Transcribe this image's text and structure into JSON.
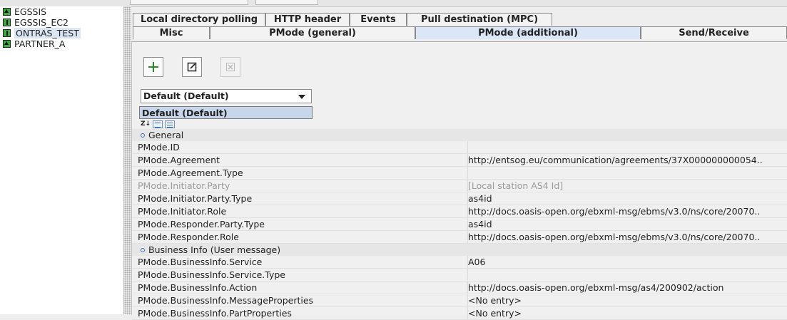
{
  "tree": {
    "items": [
      {
        "label": "EGSSIS",
        "icon": "green-up-icon",
        "selected": false
      },
      {
        "label": "EGSSIS_EC2",
        "icon": "green-info-icon",
        "selected": false
      },
      {
        "label": "ONTRAS_TEST",
        "icon": "green-info-icon",
        "selected": true
      },
      {
        "label": "PARTNER_A",
        "icon": "green-up-icon",
        "selected": false
      }
    ]
  },
  "tabs": {
    "row1": [
      "Local directory polling",
      "HTTP header",
      "Events",
      "Pull destination (MPC)"
    ],
    "row2": [
      "Misc",
      "PMode (general)",
      "PMode (additional)",
      "Send/Receive"
    ],
    "active": "PMode (additional)"
  },
  "toolbar": {
    "add_icon": "plus-icon",
    "edit_icon": "edit-icon",
    "delete_icon": "delete-icon"
  },
  "combo": {
    "selected": "Default (Default)",
    "popup_option": "Default (Default)"
  },
  "properties": {
    "groups": [
      {
        "title": "General",
        "rows": [
          {
            "key": "PMode.ID",
            "value": "",
            "disabled": false
          },
          {
            "key": "PMode.Agreement",
            "value": "http://entsog.eu/communication/agreements/37X000000000054..",
            "disabled": false
          },
          {
            "key": "PMode.Agreement.Type",
            "value": "",
            "disabled": false
          },
          {
            "key": "PMode.Initiator.Party",
            "value": "[Local station AS4 Id]",
            "disabled": true
          },
          {
            "key": "PMode.Initiator.Party.Type",
            "value": "as4id",
            "disabled": false
          },
          {
            "key": "PMode.Initiator.Role",
            "value": "http://docs.oasis-open.org/ebxml-msg/ebms/v3.0/ns/core/20070..",
            "disabled": false
          },
          {
            "key": "PMode.Responder.Party.Type",
            "value": "as4id",
            "disabled": false
          },
          {
            "key": "PMode.Responder.Role",
            "value": "http://docs.oasis-open.org/ebxml-msg/ebms/v3.0/ns/core/20070..",
            "disabled": false
          }
        ]
      },
      {
        "title": "Business Info (User message)",
        "rows": [
          {
            "key": "PMode.BusinessInfo.Service",
            "value": "A06",
            "disabled": false
          },
          {
            "key": "PMode.BusinessInfo.Service.Type",
            "value": "",
            "disabled": false
          },
          {
            "key": "PMode.BusinessInfo.Action",
            "value": "http://docs.oasis-open.org/ebxml-msg/as4/200902/action",
            "disabled": false
          },
          {
            "key": "PMode.BusinessInfo.MessageProperties",
            "value": "<No entry>",
            "disabled": false
          },
          {
            "key": "PMode.BusinessInfo.PartProperties",
            "value": "<No entry>",
            "disabled": false
          }
        ]
      }
    ]
  },
  "colors": {
    "active_tab": "#dbe7f6",
    "selection": "#c7d6ea",
    "tree_icon": "#3faa3f"
  }
}
